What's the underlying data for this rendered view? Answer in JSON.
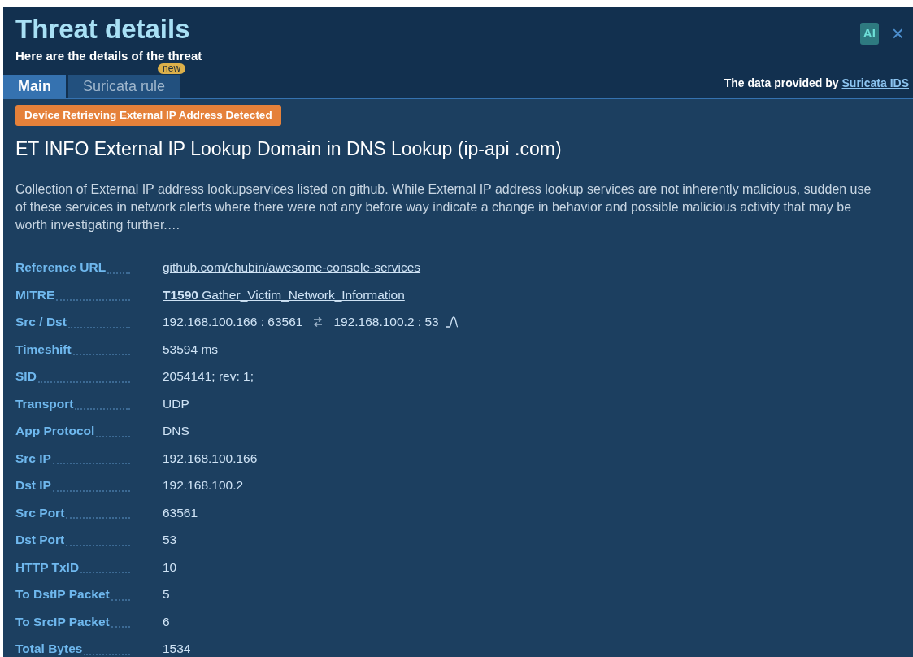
{
  "window": {
    "title": "Threat details",
    "subtitle": "Here are the details of the threat",
    "ai_badge": "AI",
    "close": "×"
  },
  "tabs": [
    {
      "label": "Main",
      "selected": true
    },
    {
      "label": "Suricata rule",
      "selected": false,
      "badge": "new"
    }
  ],
  "provider": {
    "text": "The data provided by",
    "link": "Suricata IDS"
  },
  "category_tag": "Device Retrieving External IP Address Detected",
  "heading": "ET INFO External IP Lookup Domain in DNS Lookup (ip-api .com)",
  "description": "Collection of External IP address lookupservices listed on github. While External IP address lookup services are not inherently malicious, sudden use of these services in network alerts where there were not any before way indicate a change in behavior and possible malicious activity that may be worth investigating further.…",
  "details": [
    {
      "label": "Reference URL",
      "kind": "link",
      "value": "github.com/chubin/awesome-console-services"
    },
    {
      "label": "MITRE",
      "kind": "mitre",
      "code": "T1590",
      "value": "Gather_Victim_Network_Information"
    },
    {
      "label": "Src / Dst",
      "kind": "flow",
      "src": "192.168.100.166 : 63561",
      "dst": "192.168.100.2 : 53"
    },
    {
      "label": "Timeshift",
      "kind": "text",
      "value": "53594 ms"
    },
    {
      "label": "SID",
      "kind": "text",
      "value": "2054141; rev: 1;"
    },
    {
      "label": "Transport",
      "kind": "text",
      "value": "UDP"
    },
    {
      "label": "App Protocol",
      "kind": "text",
      "value": "DNS"
    },
    {
      "label": "Src IP",
      "kind": "text",
      "value": "192.168.100.166"
    },
    {
      "label": "Dst IP",
      "kind": "text",
      "value": "192.168.100.2"
    },
    {
      "label": "Src Port",
      "kind": "text",
      "value": "63561"
    },
    {
      "label": "Dst Port",
      "kind": "text",
      "value": "53"
    },
    {
      "label": "HTTP TxID",
      "kind": "text",
      "value": "10"
    },
    {
      "label": "To DstIP Packet",
      "kind": "text",
      "value": "5"
    },
    {
      "label": "To SrcIP Packet",
      "kind": "text",
      "value": "6"
    },
    {
      "label": "Total Bytes",
      "kind": "text",
      "value": "1534"
    }
  ]
}
